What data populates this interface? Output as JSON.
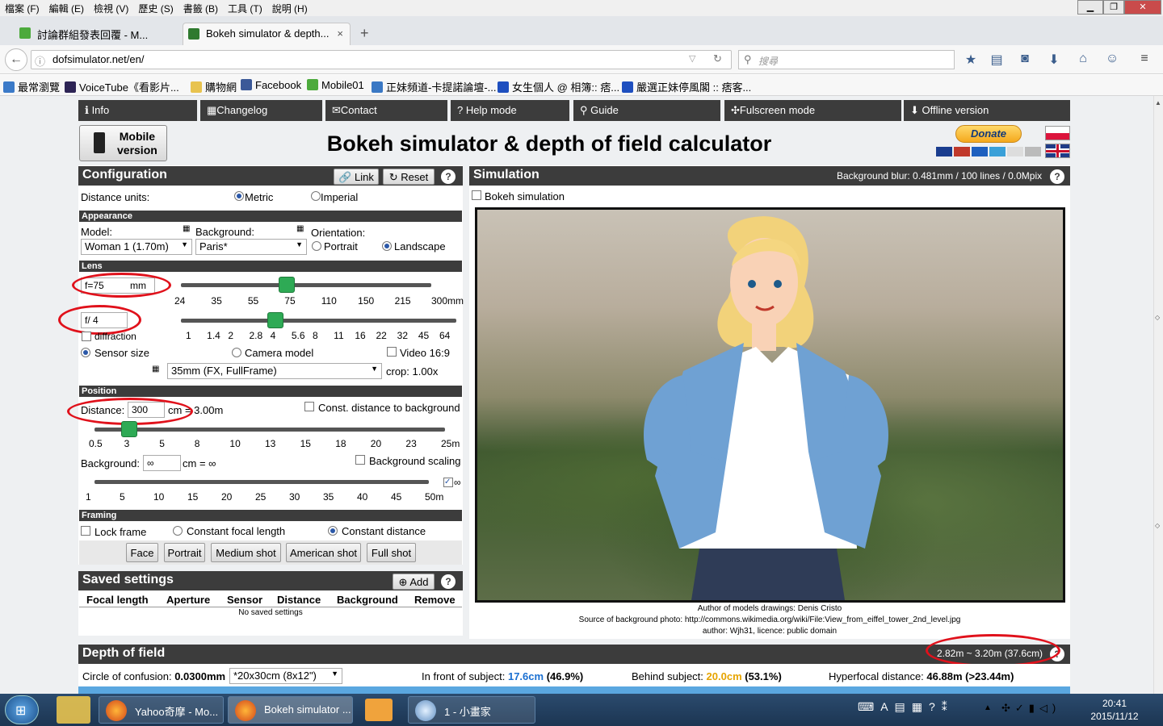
{
  "browser": {
    "menu": [
      "檔案 (F)",
      "編輯 (E)",
      "檢視 (V)",
      "歷史 (S)",
      "書籤 (B)",
      "工具 (T)",
      "說明 (H)"
    ],
    "tabs": [
      {
        "label": "討論群組發表回覆 - M..."
      },
      {
        "label": "Bokeh simulator & depth..."
      }
    ],
    "url": "dofsimulator.net/en/",
    "search_placeholder": "搜尋",
    "bookmarks": [
      "最常瀏覽",
      "VoiceTube《看影片...",
      "購物網",
      "Facebook",
      "Mobile01",
      "正妹頻道-卡提諾論壇-...",
      "女生個人 @ 相簿:: 痞...",
      "嚴選正妹停風閣 :: 痞客..."
    ]
  },
  "nav": [
    "Info",
    "Changelog",
    "Contact",
    "Help mode",
    "Guide",
    "Fulscreen mode",
    "Offline version"
  ],
  "mobile": [
    "Mobile",
    "version"
  ],
  "title": "Bokeh simulator & depth of field calculator",
  "donate": "Donate",
  "config": {
    "header": "Configuration",
    "link": "Link",
    "reset": "Reset",
    "help": "?",
    "units_label": "Distance units:",
    "metric": "Metric",
    "imperial": "Imperial",
    "appearance": "Appearance",
    "model_label": "Model:",
    "model": "Woman 1 (1.70m)",
    "background_label": "Background:",
    "background": "Paris*",
    "orientation_label": "Orientation:",
    "portrait": "Portrait",
    "landscape": "Landscape",
    "lens": "Lens",
    "f_prefix": "f=",
    "focal": "75",
    "mm": "mm",
    "focal_ticks": [
      "24",
      "35",
      "55",
      "75",
      "110",
      "150",
      "215",
      "300mm"
    ],
    "fstop": "f/ 4",
    "diffraction": "diffraction",
    "aperture_ticks": [
      "1",
      "1.4",
      "2",
      "2.8",
      "4",
      "5.6",
      "8",
      "11",
      "16",
      "22",
      "32",
      "45",
      "64"
    ],
    "sensor_size": "Sensor size",
    "camera_model": "Camera model",
    "video": "Video 16:9",
    "sensor": "35mm (FX, FullFrame)",
    "crop": "crop: 1.00x",
    "position": "Position",
    "distance_label": "Distance:",
    "distance": "300",
    "distance_unit": "cm = 3.00m",
    "const_dist": "Const. distance to background",
    "distance_ticks": [
      "0.5",
      "3",
      "5",
      "8",
      "10",
      "13",
      "15",
      "18",
      "20",
      "23",
      "25m"
    ],
    "bg_label": "Background:",
    "bg_value": "∞",
    "bg_unit": "cm = ∞",
    "bg_scaling": "Background scaling",
    "bg_ticks": [
      "1",
      "5",
      "10",
      "15",
      "20",
      "25",
      "30",
      "35",
      "40",
      "45",
      "50m"
    ],
    "inf": "∞",
    "framing": "Framing",
    "lock": "Lock frame",
    "const_focal": "Constant focal length",
    "const_distance": "Constant distance",
    "shots": [
      "Face",
      "Portrait",
      "Medium shot",
      "American shot",
      "Full shot"
    ]
  },
  "saved": {
    "header": "Saved settings",
    "add": "Add",
    "cols": [
      "Focal length",
      "Aperture",
      "Sensor",
      "Distance",
      "Background",
      "Remove"
    ],
    "empty": "No saved settings"
  },
  "sim": {
    "header": "Simulation",
    "blur": "Background blur: 0.481mm / 100 lines / 0.0Mpix",
    "bokeh": "Bokeh simulation",
    "credit1": "Author of models drawings: Denis Cristo",
    "credit2": "Source of background photo: http://commons.wikimedia.org/wiki/File:View_from_eiffel_tower_2nd_level.jpg",
    "credit3": "author: Wjh31, licence: public domain"
  },
  "dof": {
    "header": "Depth of field",
    "range": "2.82m ~ 3.20m (37.6cm)",
    "coc_label": "Circle of confusion:",
    "coc": "0.0300mm",
    "coc_sel": "*20x30cm (8x12\")",
    "front_label": "In front of subject:",
    "front_val": "17.6cm",
    "front_pct": "(46.9%)",
    "behind_label": "Behind subject:",
    "behind_val": "20.0cm",
    "behind_pct": "(53.1%)",
    "hyper_label": "Hyperfocal distance:",
    "hyper": "46.88m (>23.44m)"
  },
  "taskbar": {
    "items": [
      "Yahoo奇摩 - Mo...",
      "Bokeh simulator ...",
      "",
      "1 - 小畫家"
    ],
    "time": "20:41",
    "date": "2015/11/12"
  },
  "colors": {
    "accent_front": "#1a6fd1",
    "accent_behind": "#e6a400",
    "panel": "#3c3c3c",
    "annotation": "#e0111b"
  }
}
